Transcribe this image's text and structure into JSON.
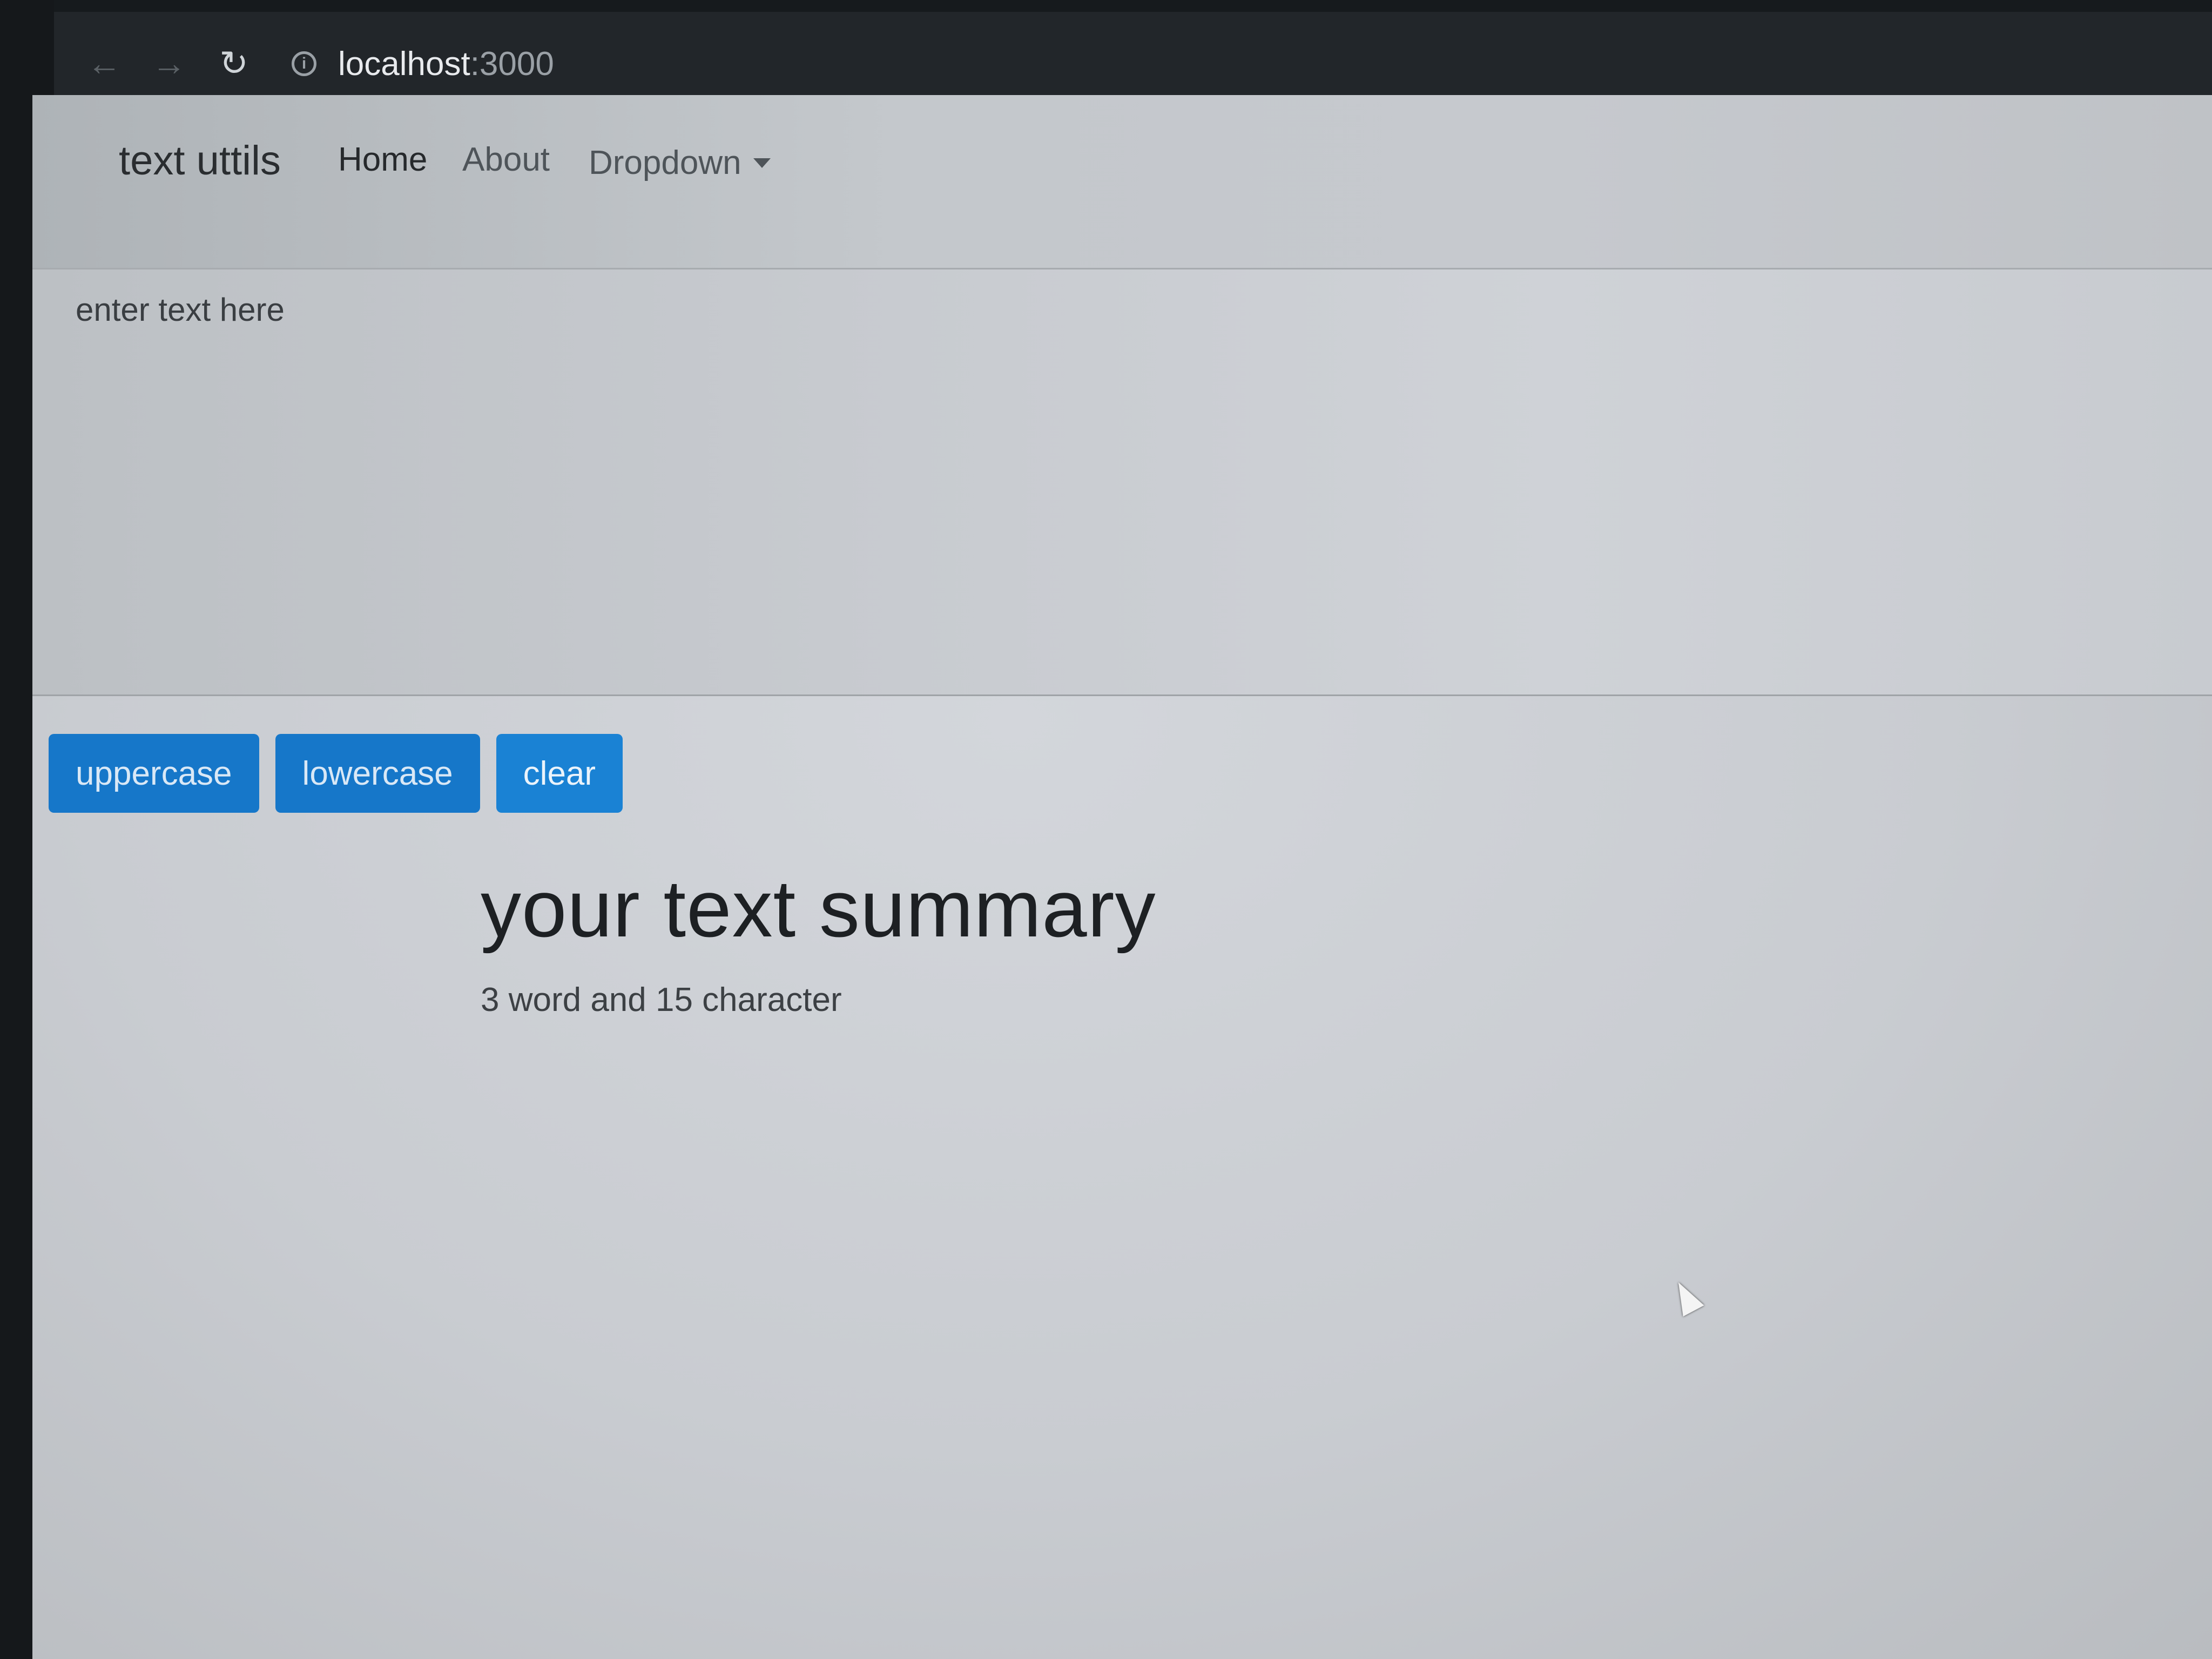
{
  "browser": {
    "url_host": "localhost",
    "url_port": ":3000",
    "back_icon": "arrow-left-icon",
    "forward_icon": "arrow-right-icon",
    "reload_icon": "reload-icon",
    "info_icon": "info-icon"
  },
  "navbar": {
    "brand": "text uttils",
    "links": [
      {
        "label": "Home"
      },
      {
        "label": "About"
      },
      {
        "label": "Dropdown"
      }
    ]
  },
  "editor": {
    "placeholder": "enter text here",
    "value": ""
  },
  "buttons": {
    "uppercase": "uppercase",
    "lowercase": "lowercase",
    "clear": "clear"
  },
  "summary": {
    "title": "your text summary",
    "counts": "3 word and 15 character"
  },
  "colors": {
    "button_primary": "#1677c9",
    "browser_bar": "#22262a",
    "page_background": "#c9ccd1"
  }
}
